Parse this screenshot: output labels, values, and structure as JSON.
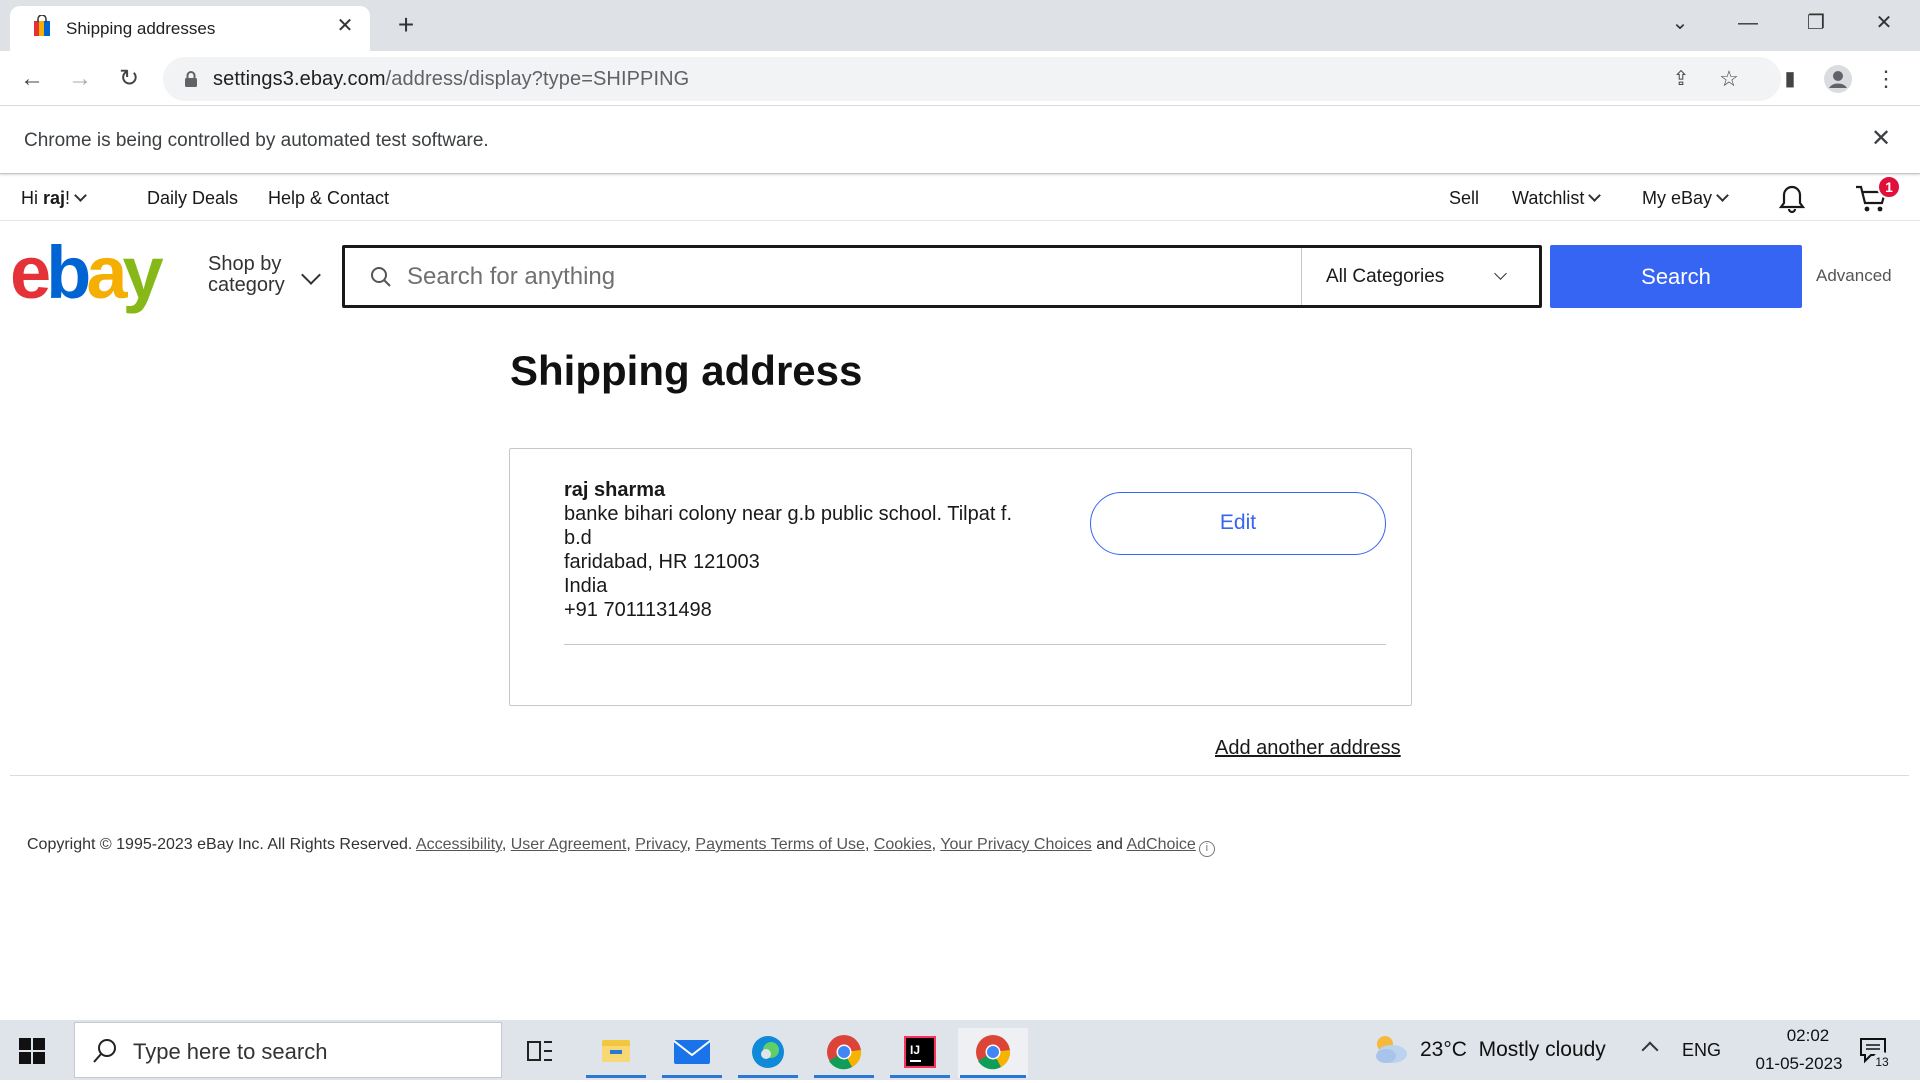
{
  "browser": {
    "tab_title": "Shipping addresses",
    "url_host": "settings3.ebay.com",
    "url_path": "/address/display?type=SHIPPING",
    "infobar_text": "Chrome is being controlled by automated test software."
  },
  "topnav": {
    "greeting_prefix": "Hi ",
    "greeting_name": "raj",
    "greeting_suffix": "!",
    "daily_deals": "Daily Deals",
    "help_contact": "Help & Contact",
    "sell": "Sell",
    "watchlist": "Watchlist",
    "my_ebay": "My eBay",
    "cart_count": "1"
  },
  "header": {
    "shop_by_line1": "Shop by",
    "shop_by_line2": "category",
    "search_placeholder": "Search for anything",
    "category_selected": "All Categories",
    "search_button": "Search",
    "advanced": "Advanced"
  },
  "main": {
    "title": "Shipping address",
    "address": {
      "name": "raj sharma",
      "line1": "banke bihari colony near g.b public school. Tilpat f.",
      "line2": "b.d",
      "city_line": "faridabad, HR 121003",
      "country": "India",
      "phone": "+91 7011131498"
    },
    "edit_button": "Edit",
    "add_address": "Add another address"
  },
  "footer": {
    "copyright": "Copyright © 1995-2023 eBay Inc. All Rights Reserved.",
    "links": [
      "Accessibility",
      "User Agreement",
      "Privacy",
      "Payments Terms of Use",
      "Cookies",
      "Your Privacy Choices"
    ],
    "and": "and",
    "adchoice": "AdChoice"
  },
  "taskbar": {
    "search_placeholder": "Type here to search",
    "weather_temp": "23°C",
    "weather_desc": "Mostly cloudy",
    "lang": "ENG",
    "time": "02:02",
    "date": "01-05-2023",
    "notif_count": "13"
  },
  "colors": {
    "accent": "#3665f3",
    "badge": "#e0103a"
  }
}
